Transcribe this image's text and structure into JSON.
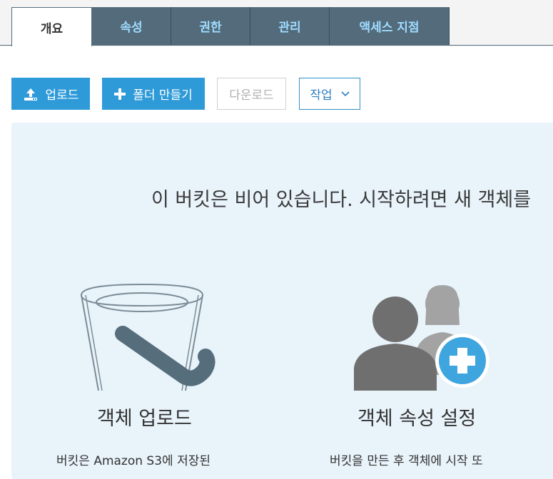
{
  "tabs": [
    {
      "label": "개요",
      "active": true
    },
    {
      "label": "속성",
      "active": false
    },
    {
      "label": "권한",
      "active": false
    },
    {
      "label": "관리",
      "active": false
    },
    {
      "label": "액세스 지점",
      "active": false
    }
  ],
  "toolbar": {
    "upload_label": "업로드",
    "create_folder_label": "폴더 만들기",
    "download_label": "다운로드",
    "actions_label": "작업"
  },
  "empty_state": {
    "message": "이 버킷은 비어 있습니다. 시작하려면 새 객체를",
    "cards": [
      {
        "icon": "bucket-icon",
        "title": "객체 업로드",
        "description": "버킷은 Amazon S3에 저장된"
      },
      {
        "icon": "users-add-icon",
        "title": "객체 속성 설정",
        "description": "버킷을 만든 후 객체에 시작 또"
      }
    ]
  },
  "colors": {
    "primary": "#2f9ad8",
    "tab_bg": "#546b7b",
    "tab_text": "#9fdcff",
    "panel_bg": "#e8f3fa"
  }
}
